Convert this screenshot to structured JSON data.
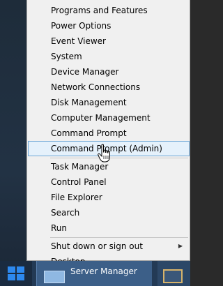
{
  "menu": {
    "items": [
      {
        "label": "Programs and Features"
      },
      {
        "label": "Power Options"
      },
      {
        "label": "Event Viewer"
      },
      {
        "label": "System"
      },
      {
        "label": "Device Manager"
      },
      {
        "label": "Network Connections"
      },
      {
        "label": "Disk Management"
      },
      {
        "label": "Computer Management"
      },
      {
        "label": "Command Prompt"
      },
      {
        "label": "Command Prompt (Admin)",
        "highlighted": true
      },
      {
        "label": "Task Manager"
      },
      {
        "label": "Control Panel"
      },
      {
        "label": "File Explorer"
      },
      {
        "label": "Search"
      },
      {
        "label": "Run"
      },
      {
        "label": "Shut down or sign out",
        "submenu": true
      },
      {
        "label": "Desktop"
      }
    ],
    "submenu_arrow": "▶"
  },
  "taskbar": {
    "start_icon": "windows-logo-icon",
    "app_label": "Server Manager",
    "app_icon": "server-manager-icon",
    "right_icon": "folder-icon"
  },
  "cursor": "hand-pointer-icon",
  "colors": {
    "menu_bg": "#f0f0f0",
    "highlight_bg": "#e5f1fb",
    "highlight_border": "#6fa7d6",
    "taskbar": "#233a55",
    "windows_blue": "#2d89ef"
  }
}
